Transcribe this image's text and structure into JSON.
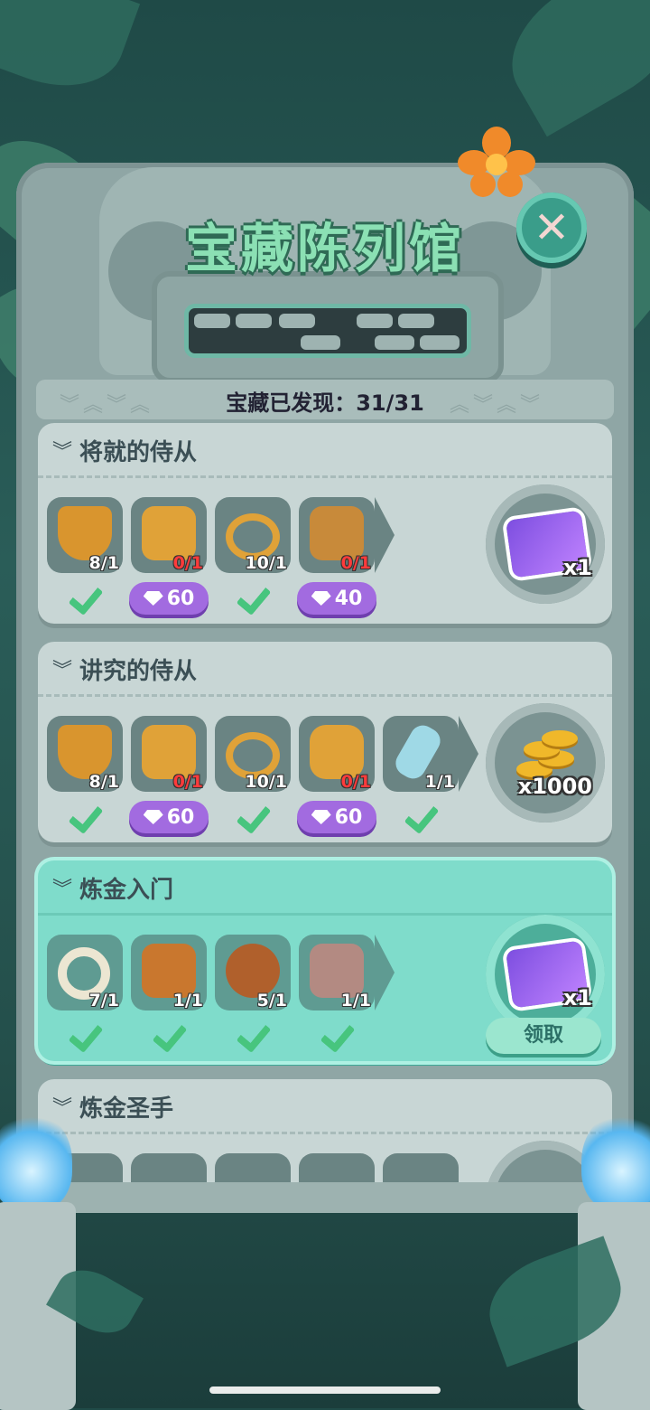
{
  "header": {
    "title": "宝藏陈列馆",
    "progress_label": "宝藏已发现：31/31"
  },
  "colors": {
    "accent": "#3a9d8a",
    "gem": "#a26be0",
    "check": "#47c57e",
    "title": "#8be0b4"
  },
  "cards": [
    {
      "title": "将就的侍从",
      "items": [
        {
          "icon": "shield-mickey-icon",
          "count": "8/1",
          "status": "check"
        },
        {
          "icon": "armor-icon",
          "count": "0/1",
          "status": "gem",
          "cost": "60"
        },
        {
          "icon": "belt-icon",
          "count": "10/1",
          "status": "check"
        },
        {
          "icon": "boots-icon",
          "count": "0/1",
          "status": "gem",
          "cost": "40"
        }
      ],
      "reward": {
        "icon": "ticket-icon",
        "count": "x1"
      }
    },
    {
      "title": "讲究的侍从",
      "items": [
        {
          "icon": "shield-mickey-icon",
          "count": "8/1",
          "status": "check"
        },
        {
          "icon": "armor-icon",
          "count": "0/1",
          "status": "gem",
          "cost": "60"
        },
        {
          "icon": "belt-icon",
          "count": "10/1",
          "status": "check"
        },
        {
          "icon": "medallion-icon",
          "count": "0/1",
          "status": "gem",
          "cost": "60"
        },
        {
          "icon": "crystal-blade-icon",
          "count": "1/1",
          "status": "check"
        }
      ],
      "reward": {
        "icon": "gold-coins-icon",
        "count": "x1000"
      }
    },
    {
      "title": "炼金入门",
      "items": [
        {
          "icon": "bone-ring-icon",
          "count": "7/1",
          "status": "check"
        },
        {
          "icon": "tiki-mask-icon",
          "count": "1/1",
          "status": "check"
        },
        {
          "icon": "tribal-shield-icon",
          "count": "5/1",
          "status": "check"
        },
        {
          "icon": "stone-tablet-icon",
          "count": "1/1",
          "status": "check"
        }
      ],
      "reward": {
        "icon": "ticket-icon",
        "count": "x1",
        "claim_label": "领取"
      }
    },
    {
      "title": "炼金圣手"
    }
  ]
}
